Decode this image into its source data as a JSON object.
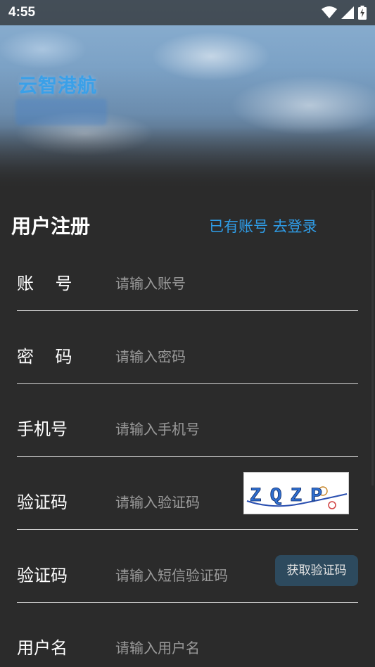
{
  "status_bar": {
    "time": "4:55"
  },
  "brand": {
    "logo_text": "云智港航"
  },
  "header": {
    "title": "用户注册",
    "login_link": "已有账号 去登录"
  },
  "form": {
    "account": {
      "label": "账    号",
      "placeholder": "请输入账号"
    },
    "password": {
      "label": "密    码",
      "placeholder": "请输入密码"
    },
    "phone": {
      "label": "手机号",
      "placeholder": "请输入手机号"
    },
    "captcha": {
      "label": "验证码",
      "placeholder": "请输入验证码",
      "image_text": "ZQZP"
    },
    "sms_code": {
      "label": "验证码",
      "placeholder": "请输入短信验证码",
      "button": "获取验证码"
    },
    "username": {
      "label": "用户名",
      "placeholder": "请输入用户名"
    }
  },
  "colors": {
    "accent": "#2f9ce6",
    "background": "#2b2b2b",
    "button_bg": "#2d4a5e"
  }
}
